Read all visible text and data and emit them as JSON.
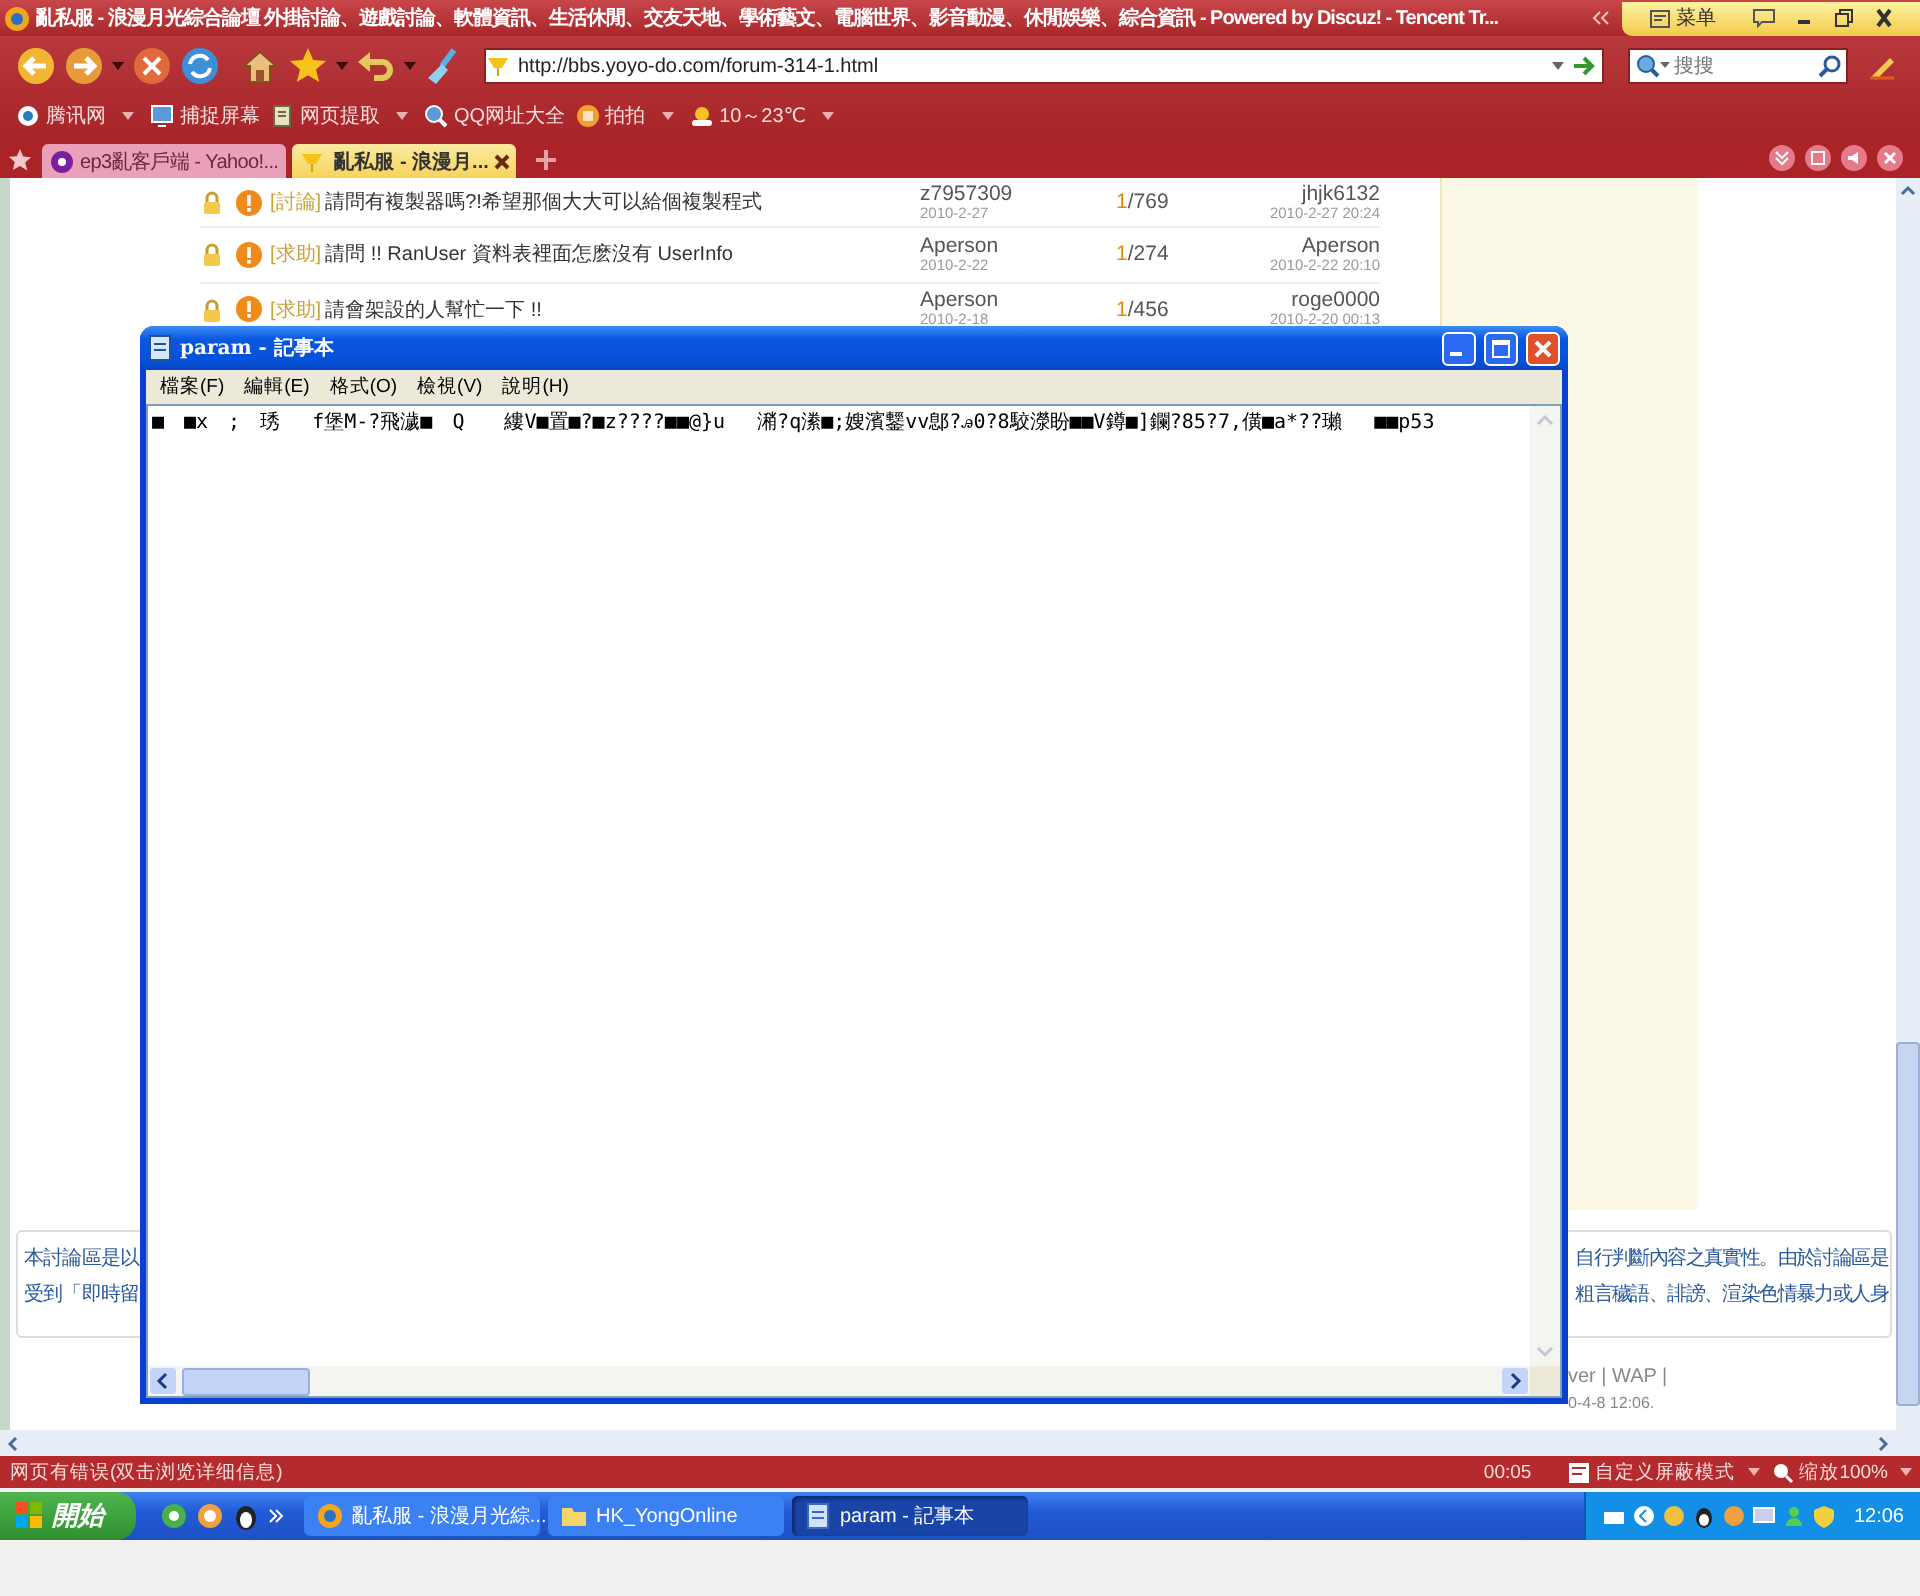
{
  "browser": {
    "title": "亂私服 - 浪漫月光綜合論壇 外掛討論、遊戲討論、軟體資訊、生活休閒、交友天地、學術藝文、電腦世界、影音動漫、休閒娛樂、綜合資訊 - Powered by Discuz! - Tencent Tr...",
    "menu_button": "菜单",
    "address": "http://bbs.yoyo-do.com/forum-314-1.html",
    "search": {
      "placeholder": "搜搜"
    },
    "links": [
      "腾讯网",
      "捕捉屏幕",
      "网页提取",
      "QQ网址大全",
      "拍拍",
      "10～23℃"
    ],
    "tabs": [
      {
        "label": "ep3亂客戶端 - Yahoo!...",
        "selected": false
      },
      {
        "label": "亂私服 - 浪漫月...",
        "selected": true
      }
    ]
  },
  "threads": [
    {
      "tag": "[討論]",
      "title": "請問有複製器嗎?!希望那個大大可以給個複製程式",
      "author": "z7957309",
      "date": "2010-2-27",
      "replies": "1",
      "views": "/769",
      "last_poster": "jhjk6132",
      "last_time": "2010-2-27 20:24"
    },
    {
      "tag": "[求助]",
      "title": "請問 !! RanUser 資料表裡面怎麽沒有 UserInfo",
      "author": "Aperson",
      "date": "2010-2-22",
      "replies": "1",
      "views": "/274",
      "last_poster": "Aperson",
      "last_time": "2010-2-22 20:10"
    },
    {
      "tag": "[求助]",
      "title": "請會架設的人幫忙一下 !!",
      "author": "Aperson",
      "date": "2010-2-18",
      "replies": "1",
      "views": "/456",
      "last_poster": "roge0000",
      "last_time": "2010-2-20 00:13"
    }
  ],
  "notice": {
    "left": [
      "本討論區是以",
      "受到「即時留"
    ],
    "right": [
      "自行判斷內容之真實性。由於討論區是",
      "粗言穢語、誹謗、渲染色情暴力或人身"
    ]
  },
  "footer": {
    "links": "ver | WAP |",
    "time": "0-4-8 12:06."
  },
  "status_bar": {
    "message": "网页有错误(双击浏览详细信息)",
    "time": "00:05",
    "mode": "自定义屏蔽模式",
    "zoom": "缩放100%"
  },
  "notepad": {
    "title": "param - 記事本",
    "menu": [
      "檔案(F)",
      "編輯(E)",
      "格式(O)",
      "檢視(V)",
      "說明(H)"
    ],
    "text": "■　■x　;　琇　 f堡M-?飛濊■　Q　　縷V■置■?■z????■■@}u　 潲?q潫■;嫂濱鑋vv鄎?ꭿ0?8駮濴盼■■V鐏■]鑭?85?7,僙■a*??瓎　 ■■p53"
  },
  "taskbar": {
    "start": "開始",
    "tasks": [
      {
        "label": "亂私服 - 浪漫月光綜...",
        "kind": "browser",
        "selected": false
      },
      {
        "label": "HK_YongOnline",
        "kind": "folder",
        "selected": false
      },
      {
        "label": "param - 記事本",
        "kind": "notepad",
        "selected": true
      }
    ],
    "clock": "12:06"
  }
}
